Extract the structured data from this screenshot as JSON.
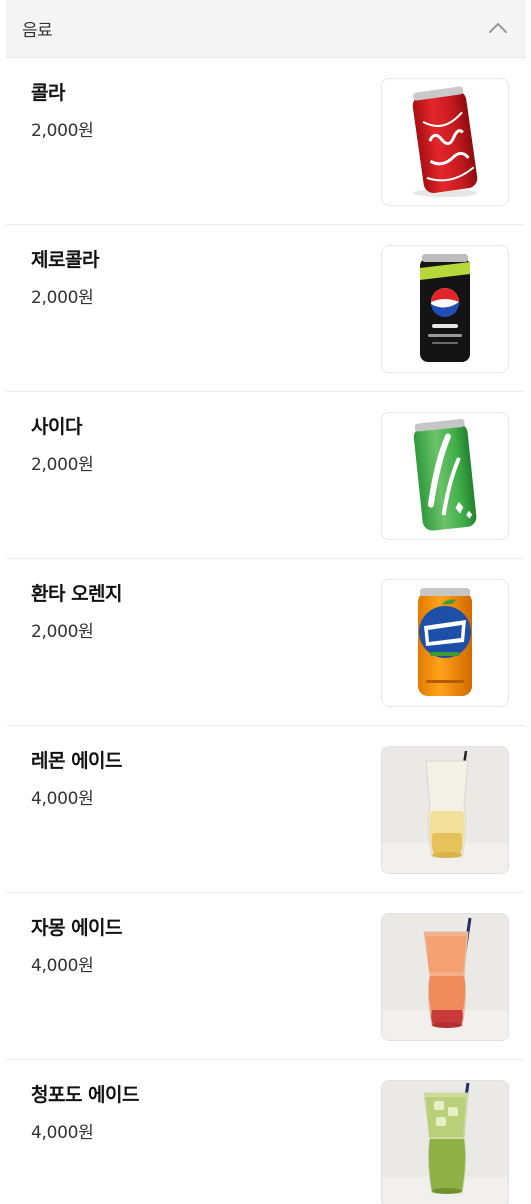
{
  "section": {
    "title": "음료"
  },
  "items": [
    {
      "name": "콜라",
      "price": "2,000원",
      "image": "cola-can"
    },
    {
      "name": "제로콜라",
      "price": "2,000원",
      "image": "zero-cola-can"
    },
    {
      "name": "사이다",
      "price": "2,000원",
      "image": "cider-can"
    },
    {
      "name": "환타 오렌지",
      "price": "2,000원",
      "image": "fanta-orange-can"
    },
    {
      "name": "레몬 에이드",
      "price": "4,000원",
      "image": "lemonade-glass"
    },
    {
      "name": "자몽 에이드",
      "price": "4,000원",
      "image": "grapefruit-ade-glass"
    },
    {
      "name": "청포도 에이드",
      "price": "4,000원",
      "image": "green-grape-ade-glass"
    }
  ],
  "colors": {
    "header_bg": "#f4f4f4",
    "divider": "#ececec"
  }
}
